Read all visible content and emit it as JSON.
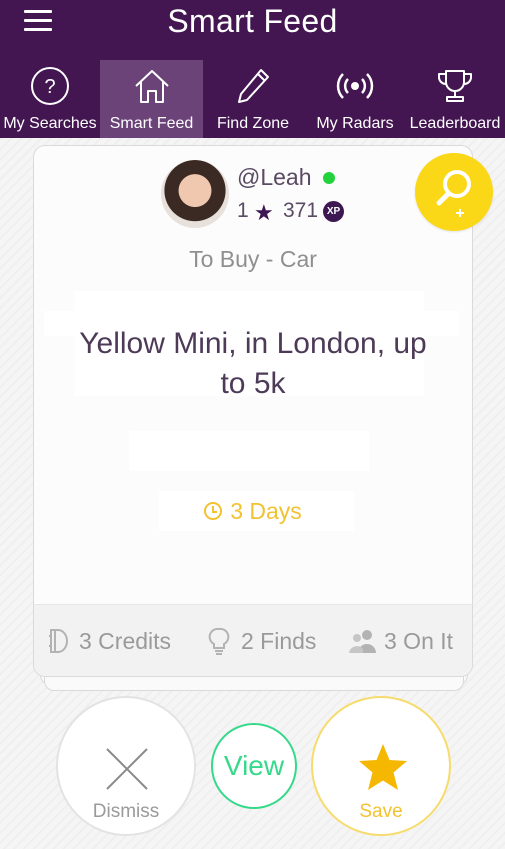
{
  "header": {
    "title": "Smart Feed"
  },
  "tabs": [
    {
      "label": "My Searches",
      "icon": "question-circle-icon"
    },
    {
      "label": "Smart Feed",
      "icon": "home-icon",
      "active": true
    },
    {
      "label": "Find Zone",
      "icon": "pencil-icon"
    },
    {
      "label": "My Radars",
      "icon": "radar-icon"
    },
    {
      "label": "Leaderboard",
      "icon": "trophy-icon"
    }
  ],
  "card": {
    "username": "@Leah",
    "online": true,
    "rank": "1",
    "xp": "371",
    "xp_badge": "XP",
    "category": "To Buy - Car",
    "request": "Yellow Mini, in London, up to 5k",
    "time_left": "3 Days",
    "stats": {
      "credits": "3 Credits",
      "finds": "2 Finds",
      "on_it": "3 On It"
    }
  },
  "actions": {
    "dismiss": "Dismiss",
    "view": "View",
    "save": "Save"
  },
  "colors": {
    "brand_purple": "#431651",
    "tab_active": "#6c4379",
    "accent_yellow": "#fad818",
    "view_green": "#36d98a",
    "online_green": "#22d23c"
  }
}
